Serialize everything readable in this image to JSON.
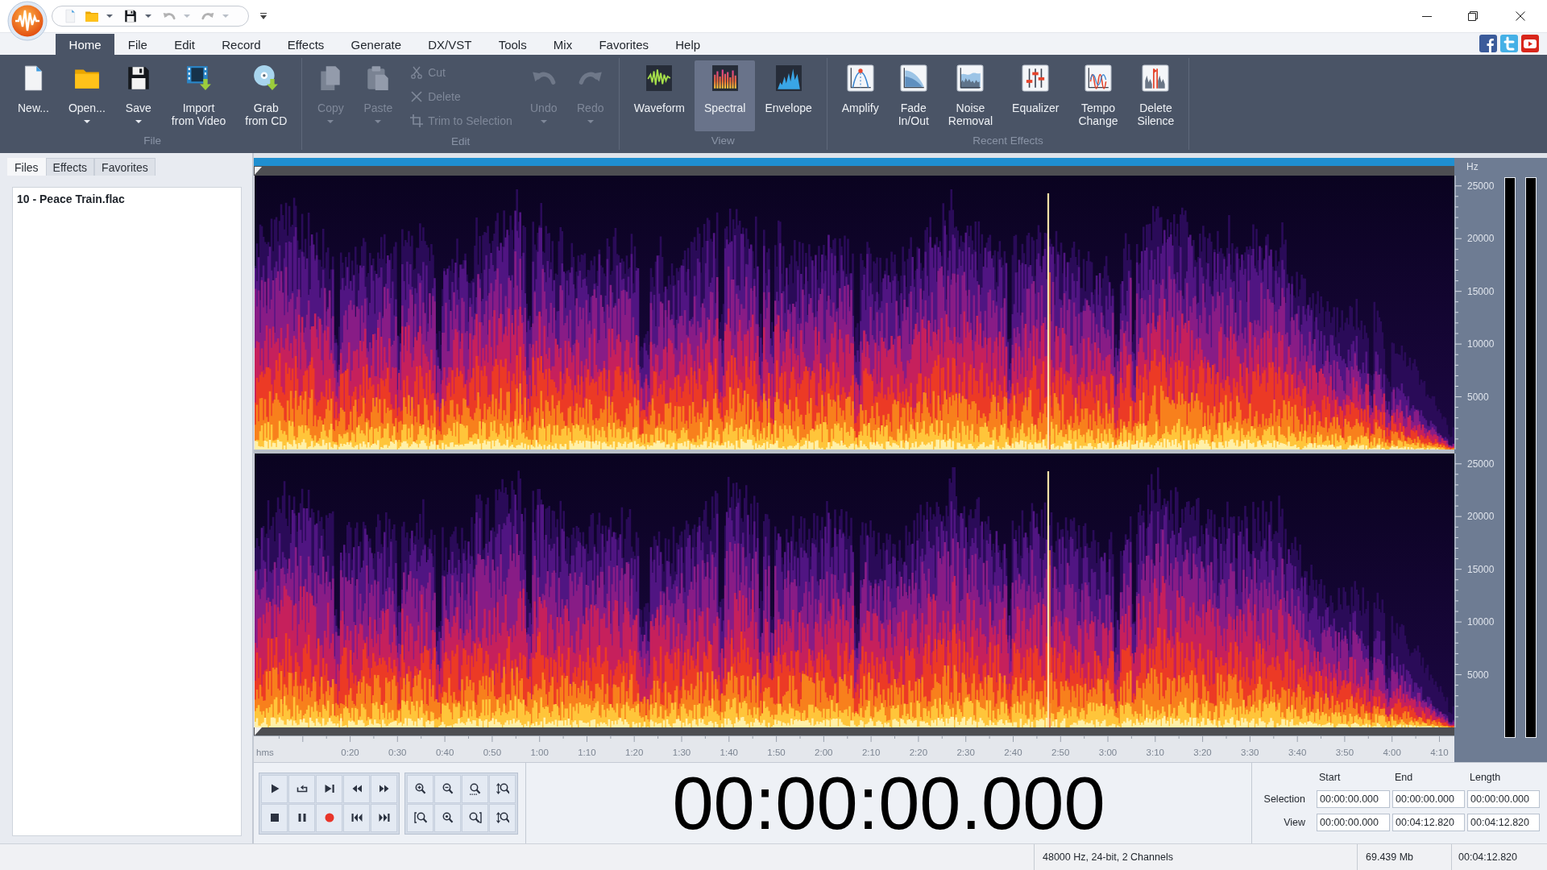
{
  "title_bar": {
    "quick_access": [
      {
        "dropdown": false,
        "disabled": false
      },
      {
        "dropdown": true,
        "disabled": false
      },
      {
        "dropdown": true,
        "disabled": false
      },
      {
        "dropdown": true,
        "disabled": true
      },
      {
        "dropdown": true,
        "disabled": true
      }
    ]
  },
  "menu_tabs": [
    {
      "label": "Home",
      "selected": true
    },
    {
      "label": "File",
      "selected": false
    },
    {
      "label": "Edit",
      "selected": false
    },
    {
      "label": "Record",
      "selected": false
    },
    {
      "label": "Effects",
      "selected": false
    },
    {
      "label": "Generate",
      "selected": false
    },
    {
      "label": "DX/VST",
      "selected": false
    },
    {
      "label": "Tools",
      "selected": false
    },
    {
      "label": "Mix",
      "selected": false
    },
    {
      "label": "Favorites",
      "selected": false
    },
    {
      "label": "Help",
      "selected": false
    }
  ],
  "ribbon": {
    "groups": [
      {
        "label": "File",
        "buttons": [
          {
            "kind": "large",
            "label": "New...",
            "dropdown": false,
            "disabled": false
          },
          {
            "kind": "large",
            "label": "Open...",
            "dropdown": true,
            "disabled": false
          },
          {
            "kind": "large",
            "label": "Save",
            "dropdown": true,
            "disabled": false
          },
          {
            "kind": "large",
            "label": "Import\nfrom Video",
            "dropdown": false,
            "disabled": false
          },
          {
            "kind": "large",
            "label": "Grab\nfrom CD",
            "dropdown": false,
            "disabled": false
          }
        ]
      },
      {
        "label": "Edit",
        "buttons": [
          {
            "kind": "large",
            "label": "Copy",
            "dropdown": true,
            "disabled": true
          },
          {
            "kind": "large",
            "label": "Paste",
            "dropdown": true,
            "disabled": true
          },
          {
            "kind": "small",
            "label": "Cut",
            "dropdown": false,
            "disabled": true
          },
          {
            "kind": "small",
            "label": "Delete",
            "dropdown": false,
            "disabled": true
          },
          {
            "kind": "small",
            "label": "Trim to Selection",
            "dropdown": false,
            "disabled": true
          },
          {
            "kind": "large",
            "label": "Undo",
            "dropdown": true,
            "disabled": true
          },
          {
            "kind": "large",
            "label": "Redo",
            "dropdown": true,
            "disabled": true
          }
        ]
      },
      {
        "label": "View",
        "buttons": [
          {
            "kind": "large",
            "label": "Waveform",
            "dropdown": false,
            "disabled": false,
            "selected": false
          },
          {
            "kind": "large",
            "label": "Spectral",
            "dropdown": false,
            "disabled": false,
            "selected": true
          },
          {
            "kind": "large",
            "label": "Envelope",
            "dropdown": false,
            "disabled": false,
            "selected": false
          }
        ]
      },
      {
        "label": "Recent Effects",
        "buttons": [
          {
            "kind": "large",
            "label": "Amplify",
            "dropdown": false,
            "disabled": false
          },
          {
            "kind": "large",
            "label": "Fade\nIn/Out",
            "dropdown": false,
            "disabled": false
          },
          {
            "kind": "large",
            "label": "Noise\nRemoval",
            "dropdown": false,
            "disabled": false
          },
          {
            "kind": "large",
            "label": "Equalizer",
            "dropdown": false,
            "disabled": false
          },
          {
            "kind": "large",
            "label": "Tempo\nChange",
            "dropdown": false,
            "disabled": false
          },
          {
            "kind": "large",
            "label": "Delete\nSilence",
            "dropdown": false,
            "disabled": false
          }
        ]
      }
    ]
  },
  "side_panel": {
    "tabs": [
      {
        "label": "Files",
        "selected": true
      },
      {
        "label": "Effects",
        "selected": false
      },
      {
        "label": "Favorites",
        "selected": false
      }
    ],
    "files": [
      "10 - Peace Train.flac"
    ]
  },
  "spectrogram": {
    "unit_label": "Hz",
    "channels": [
      {
        "frequency_labels": [
          "25000",
          "20000",
          "15000",
          "10000",
          "5000"
        ]
      },
      {
        "frequency_labels": [
          "25000",
          "20000",
          "15000",
          "10000",
          "5000"
        ]
      }
    ],
    "time_axis": {
      "unit_label": "hms",
      "labels": [
        "0:20",
        "0:30",
        "0:40",
        "0:50",
        "1:00",
        "1:10",
        "1:20",
        "1:30",
        "1:40",
        "1:50",
        "2:00",
        "2:10",
        "2:20",
        "2:30",
        "2:40",
        "2:50",
        "3:00",
        "3:10",
        "3:20",
        "3:30",
        "3:40",
        "3:50",
        "4:00",
        "4:10"
      ]
    }
  },
  "time_display": "00:00:00.000",
  "selection_panel": {
    "columns": [
      "Start",
      "End",
      "Length"
    ],
    "rows": [
      {
        "label": "Selection",
        "values": [
          "00:00:00.000",
          "00:00:00.000",
          "00:00:00.000"
        ]
      },
      {
        "label": "View",
        "values": [
          "00:00:00.000",
          "00:04:12.820",
          "00:04:12.820"
        ]
      }
    ]
  },
  "status_bar": {
    "fields": [
      "48000 Hz, 24-bit, 2 Channels",
      "69.439 Mb",
      "00:04:12.820"
    ]
  }
}
